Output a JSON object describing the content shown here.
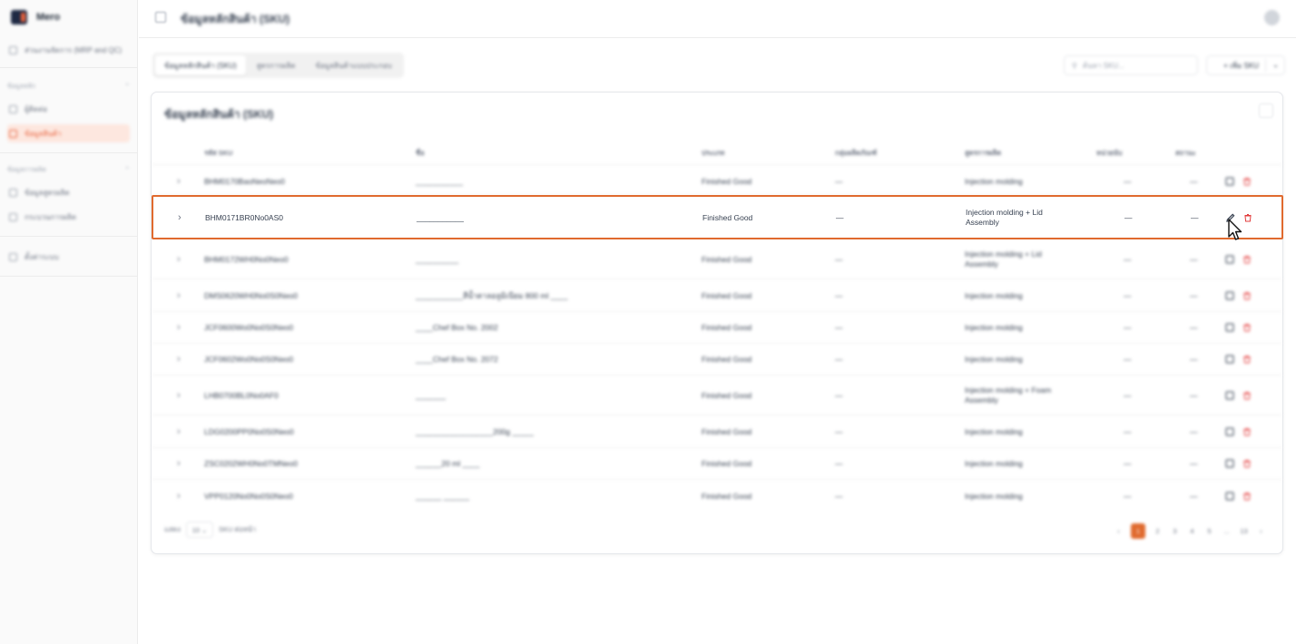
{
  "sidebar": {
    "app_name": "Mero",
    "top_item": "ส่วนงานจัดการ (MRP and QC)",
    "section1_title": "ข้อมูลหลัก",
    "section1_items": [
      "ผู้ติดต่อ",
      "ข้อมูลสินค้า"
    ],
    "section2_title": "ข้อมูลการผลิต",
    "section2_items": [
      "ข้อมูลสูตรผลิต",
      "กระบวนการผลิต"
    ],
    "bottom_item": "ตั้งค่าระบบ"
  },
  "topbar": {
    "title": "ข้อมูลหลักสินค้า (SKU)"
  },
  "tabs": [
    "ข้อมูลหลักสินค้า (SKU)",
    "สูตรการผลิต",
    "ข้อมูลสินค้าแบบประกอบ"
  ],
  "search": {
    "placeholder": "ค้นหา SKU..."
  },
  "add_button": {
    "label": "+ เพิ่ม SKU"
  },
  "card": {
    "title": "ข้อมูลหลักสินค้า (SKU)"
  },
  "columns": [
    "รหัส SKU",
    "ชื่อ",
    "ประเภท",
    "กลุ่มผลิตภัณฑ์",
    "สูตรการผลิต",
    "หน่วยนับ",
    "สถานะ"
  ],
  "rows": [
    {
      "code": "BHM0170BaoNeoNeo0",
      "name": "___________",
      "type": "Finished Good",
      "group": "—",
      "formula": "Injection molding",
      "unit": "—",
      "status": "—"
    },
    {
      "code": "BHM0171BR0No0AS0",
      "name": "___________",
      "type": "Finished Good",
      "group": "—",
      "formula": "Injection molding + Lid Assembly",
      "unit": "—",
      "status": "—"
    },
    {
      "code": "BHM0172WH0No0Neo0",
      "name": "__________",
      "type": "Finished Good",
      "group": "—",
      "formula": "Injection molding + Lid Assembly",
      "unit": "—",
      "status": "—"
    },
    {
      "code": "DMS0620WH0No0S0Neo0",
      "name": "___________สีน้ำตาลอลูมิเนียม 800 ml ____",
      "type": "Finished Good",
      "group": "—",
      "formula": "Injection molding",
      "unit": "—",
      "status": "—"
    },
    {
      "code": "JCF0600Wo0No0S0Neo0",
      "name": "____Chef Box No. 2002",
      "type": "Finished Good",
      "group": "—",
      "formula": "Injection molding",
      "unit": "—",
      "status": "—"
    },
    {
      "code": "JCF0602Wo0No0S0Neo0",
      "name": "____Chef Box No. 2072",
      "type": "Finished Good",
      "group": "—",
      "formula": "Injection molding",
      "unit": "—",
      "status": "—"
    },
    {
      "code": "LHB0700BL0No0AF0",
      "name": "_______",
      "type": "Finished Good",
      "group": "—",
      "formula": "Injection molding + Foam Assembly",
      "unit": "—",
      "status": "—"
    },
    {
      "code": "LDG0200PP0No0S0Neo0",
      "name": "__________________200g _____",
      "type": "Finished Good",
      "group": "—",
      "formula": "Injection molding",
      "unit": "—",
      "status": "—"
    },
    {
      "code": "ZSC0202WH0No0TMNeo0",
      "name": "______20 ml ____",
      "type": "Finished Good",
      "group": "—",
      "formula": "Injection molding",
      "unit": "—",
      "status": "—"
    },
    {
      "code": "VPP0120No0No0S0Neo0",
      "name": "______ ______",
      "type": "Finished Good",
      "group": "—",
      "formula": "Injection molding",
      "unit": "—",
      "status": "—"
    }
  ],
  "footer": {
    "show_label": "แสดง",
    "page_size": "10",
    "suffix": "SKU ต่อหน้า"
  },
  "pagination": {
    "pages": [
      "1",
      "2",
      "3",
      "4",
      "5",
      "...",
      "13"
    ],
    "current": "1"
  },
  "colors": {
    "accent": "#e06a2e",
    "delete": "#e23b3b"
  }
}
